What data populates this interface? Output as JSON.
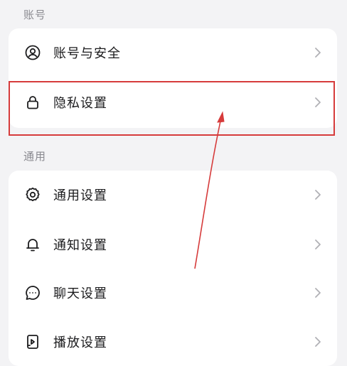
{
  "sections": {
    "account": {
      "title": "账号",
      "items": [
        {
          "label": "账号与安全",
          "icon": "user-circle-icon"
        },
        {
          "label": "隐私设置",
          "icon": "lock-icon"
        }
      ]
    },
    "general": {
      "title": "通用",
      "items": [
        {
          "label": "通用设置",
          "icon": "gear-icon"
        },
        {
          "label": "通知设置",
          "icon": "bell-icon"
        },
        {
          "label": "聊天设置",
          "icon": "chat-bubble-icon"
        },
        {
          "label": "播放设置",
          "icon": "play-settings-icon"
        }
      ]
    }
  },
  "colors": {
    "background": "#f3f3f5",
    "card": "#ffffff",
    "text": "#1c1c1e",
    "section_label": "#8a8a90",
    "chevron": "#b0b0b5",
    "annotation": "#d63b3b"
  }
}
